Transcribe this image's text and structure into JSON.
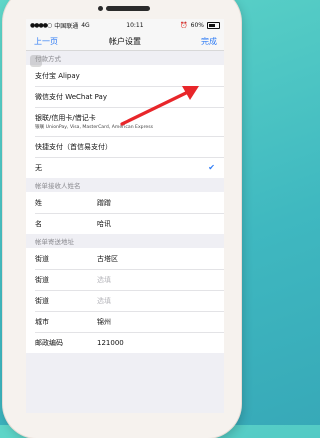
{
  "status_bar": {
    "carrier": "中国联通",
    "network": "4G",
    "time": "10:11",
    "battery": "60%"
  },
  "nav": {
    "back": "上一页",
    "title": "帐户设置",
    "done": "完成"
  },
  "payment": {
    "header": "付款方式",
    "options": [
      {
        "label": "支付宝 Alipay"
      },
      {
        "label": "微信支付 WeChat Pay"
      },
      {
        "label": "银联/信用卡/借记卡",
        "sub": "银联 UnionPay, Visa, MasterCard, American Express"
      },
      {
        "label": "快捷支付（首信易支付）"
      },
      {
        "label": "无"
      }
    ]
  },
  "recipient": {
    "header": "帐单接收人姓名",
    "rows": [
      {
        "label": "姓",
        "value": "蹭蹭"
      },
      {
        "label": "名",
        "value": "哈讯"
      }
    ]
  },
  "address": {
    "header": "帐单寄送地址",
    "rows": [
      {
        "label": "街道",
        "value": "古塔区"
      },
      {
        "label": "街道",
        "placeholder": "选填"
      },
      {
        "label": "街道",
        "placeholder": "选填"
      },
      {
        "label": "城市",
        "value": "锦州"
      },
      {
        "label": "邮政编码",
        "value": "121000"
      }
    ]
  },
  "colors": {
    "accent": "#2f7cf6",
    "arrow": "#e8262a",
    "background": "#3fb8c0"
  }
}
